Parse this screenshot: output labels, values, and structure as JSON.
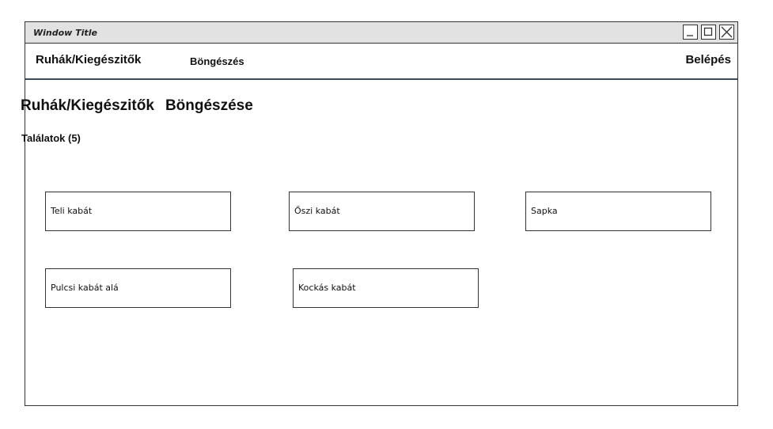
{
  "window": {
    "title": "Window Title",
    "controls": [
      "minimize-icon",
      "maximize-icon",
      "close-icon"
    ]
  },
  "navbar": {
    "brand": "Ruhák/Kiegészitők",
    "browse": "Böngészés",
    "login": "Belépés"
  },
  "page": {
    "title_part1": "Ruhák/Kiegészitők",
    "title_part2": "Böngészése",
    "results_label": "Találatok (5)"
  },
  "products": [
    {
      "name": "Teli kabát"
    },
    {
      "name": "Őszi kabát"
    },
    {
      "name": "Sapka"
    },
    {
      "name": "Pulcsi kabát alá"
    },
    {
      "name": "Kockás kabát"
    }
  ]
}
